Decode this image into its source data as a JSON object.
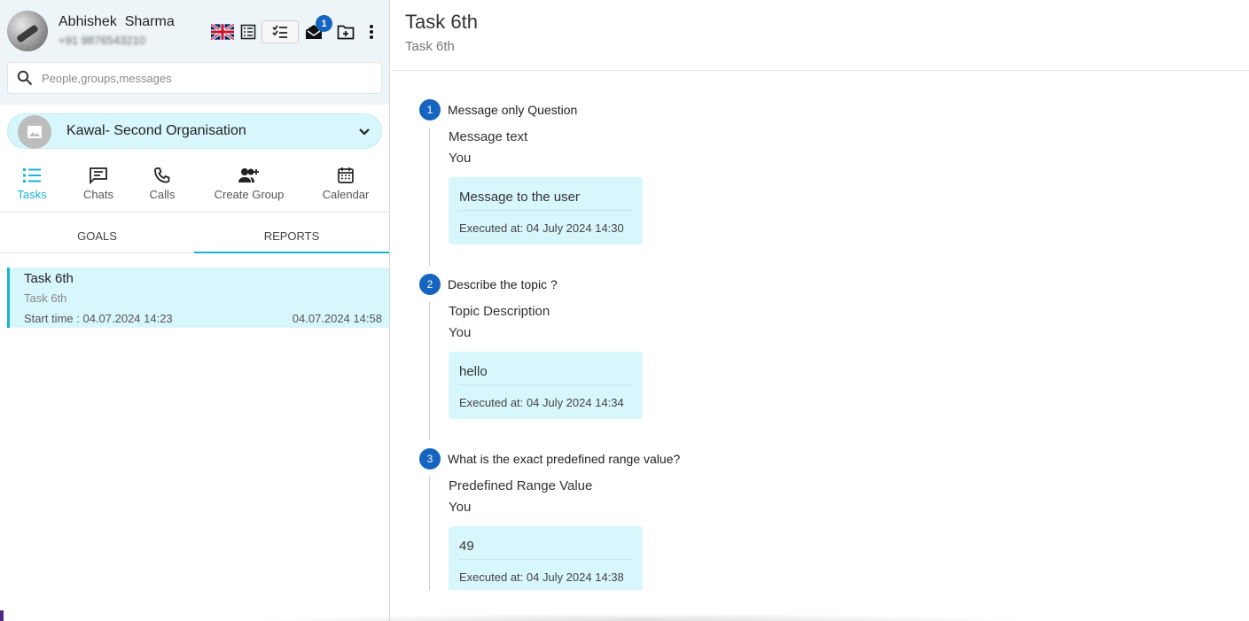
{
  "profile": {
    "name": "Abhishek  Sharma",
    "phone": "+91 9876543210"
  },
  "toolbar": {
    "notification_count": "1"
  },
  "search": {
    "placeholder": "People,groups,messages"
  },
  "organisation": {
    "name": "Kawal- Second Organisation"
  },
  "nav": {
    "tasks": "Tasks",
    "chats": "Chats",
    "calls": "Calls",
    "create_group": "Create Group",
    "calendar": "Calendar"
  },
  "subtabs": {
    "goals": "GOALS",
    "reports": "REPORTS"
  },
  "task_list": [
    {
      "title": "Task 6th",
      "subtitle": "Task 6th",
      "start": "Start time : 04.07.2024 14:23",
      "end": "04.07.2024 14:58"
    }
  ],
  "detail": {
    "title": "Task 6th",
    "subtitle": "Task 6th",
    "steps": [
      {
        "num": "1",
        "question": "Message only Question",
        "label": "Message text",
        "user": "You",
        "answer": "Message to the user",
        "executed": "Executed at: 04 July 2024 14:30"
      },
      {
        "num": "2",
        "question": "Describe the topic ?",
        "label": "Topic Description",
        "user": "You",
        "answer": "hello",
        "executed": "Executed at: 04 July 2024 14:34"
      },
      {
        "num": "3",
        "question": "What is the exact predefined range value?",
        "label": "Predefined Range Value",
        "user": "You",
        "answer": "49",
        "executed": "Executed at: 04 July 2024 14:38"
      }
    ]
  },
  "colors": {
    "accent": "#1ab3d8",
    "step_badge": "#1565c0",
    "highlight_bg": "#d8f7fc"
  }
}
